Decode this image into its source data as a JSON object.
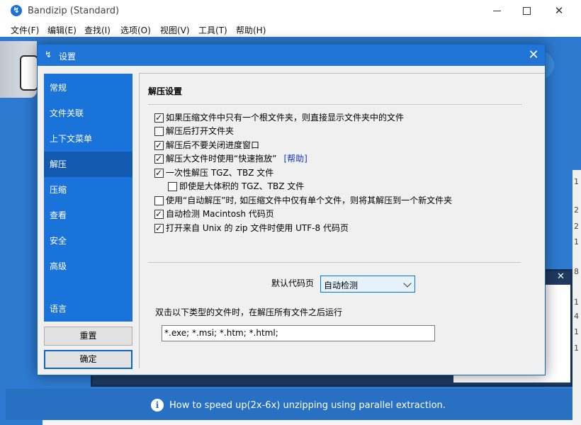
{
  "app": {
    "title": "Bandizip (Standard)",
    "logo_glyph": "↯",
    "window_controls": {
      "minimize_icon": "minimize-icon",
      "maximize_icon": "maximize-icon",
      "close_glyph": "✕"
    }
  },
  "menu": [
    "文件(F)",
    "编辑(E)",
    "查找(I)",
    "选项(O)",
    "视图(V)",
    "工具(T)",
    "帮助(H)"
  ],
  "background": {
    "right_strip_numbers": [
      "1",
      "2",
      "2",
      "1",
      "8",
      "1",
      "4",
      "1",
      "1"
    ],
    "panel_close_glyph": "✕"
  },
  "status_bar": {
    "info_glyph": "i",
    "text": "How to speed up(2x-6x) unzipping using parallel extraction."
  },
  "dialog": {
    "title_icon": "↯",
    "title": "设置",
    "close_glyph": "✕",
    "nav_items": [
      "常规",
      "文件关联",
      "上下文菜单",
      "解压",
      "压缩",
      "查看",
      "安全",
      "高级",
      "语言"
    ],
    "active_nav": "解压",
    "reset_button": "重置",
    "ok_button": "确定",
    "section_title": "解压设置",
    "options": [
      {
        "label": "如果压缩文件中只有一个根文件夹，则直接显示文件夹中的文件",
        "checked": true
      },
      {
        "label": "解压后打开文件夹",
        "checked": false
      },
      {
        "label": "解压后不要关闭进度窗口",
        "checked": true
      },
      {
        "label": "解压大文件时使用“快速拖放”",
        "checked": true,
        "link": "[帮助]"
      },
      {
        "label": "一次性解压 TGZ、TBZ 文件",
        "checked": true
      },
      {
        "label": "即使是大体积的 TGZ、TBZ 文件",
        "checked": false
      },
      {
        "label": "使用“自动解压”时, 如压缩文件中仅有单个文件，则将其解压到一个新文件夹",
        "checked": false
      },
      {
        "label": "自动检测 Macintosh 代码页",
        "checked": true
      },
      {
        "label": "打开来自 Unix 的 zip 文件时使用 UTF-8 代码页",
        "checked": true
      }
    ],
    "codepage_label": "默认代码页",
    "codepage_value": "自动检测",
    "run_label": "双击以下类型的文件时，在解压所有文件之后运行",
    "run_extensions": "*.exe; *.msi; *.htm; *.html;"
  }
}
